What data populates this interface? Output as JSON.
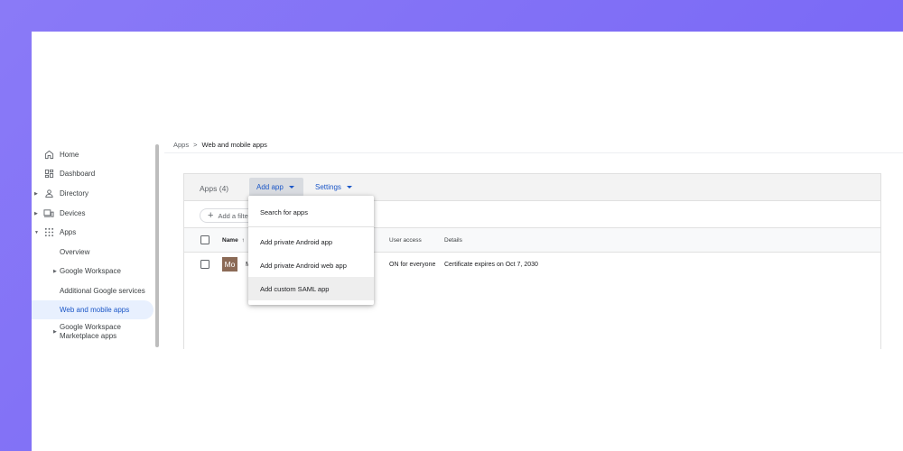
{
  "sidebar": {
    "items": [
      {
        "label": "Home",
        "icon": "home-icon"
      },
      {
        "label": "Dashboard",
        "icon": "dashboard-icon"
      },
      {
        "label": "Directory",
        "icon": "person-icon"
      },
      {
        "label": "Devices",
        "icon": "devices-icon"
      },
      {
        "label": "Apps",
        "icon": "apps-grid-icon"
      },
      {
        "label": "Overview"
      },
      {
        "label": "Google Workspace"
      },
      {
        "label": "Additional Google services"
      },
      {
        "label": "Web and mobile apps"
      },
      {
        "label": "Google Workspace\nMarketplace apps"
      }
    ]
  },
  "breadcrumb": {
    "parent": "Apps",
    "separator": ">",
    "current": "Web and mobile apps"
  },
  "card": {
    "apps_count": "Apps (4)",
    "add_app_label": "Add app",
    "settings_label": "Settings",
    "filter_label": "Add a filter"
  },
  "table": {
    "columns": {
      "name": "Name",
      "sort_arrow": "↑",
      "user_access": "User access",
      "details": "Details"
    },
    "rows": [
      {
        "avatar": "Mo",
        "name": "M",
        "user_access": "ON for everyone",
        "details": "Certificate expires on Oct 7, 2030"
      }
    ]
  },
  "menu": {
    "items": [
      "Search for apps",
      "Add private Android app",
      "Add private Android web app",
      "Add custom SAML app"
    ]
  },
  "colors": {
    "accent": "#1a56c7",
    "active_bg": "#e8f0fe",
    "backdrop": "#7b6cf6",
    "avatar": "#8b6a56"
  }
}
